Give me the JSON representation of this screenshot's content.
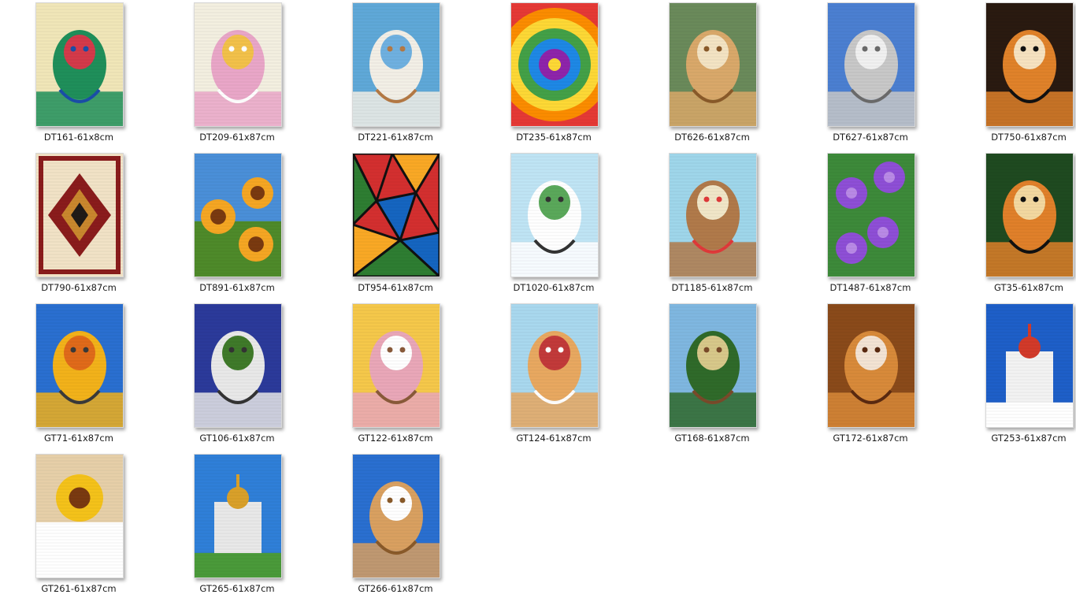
{
  "files": [
    {
      "name": "DT161-61x8cm",
      "art": "peacock",
      "colors": [
        "#f0e6b8",
        "#1f8f5a",
        "#1a4fa8",
        "#d43a4a"
      ]
    },
    {
      "name": "DT209-61x87cm",
      "art": "duck",
      "colors": [
        "#f3efe0",
        "#e9a6c8",
        "#ffffff",
        "#f2c14a"
      ]
    },
    {
      "name": "DT221-61x87cm",
      "art": "rabbit",
      "colors": [
        "#5fa8d8",
        "#f2efe6",
        "#b57a45",
        "#6fb0e0"
      ]
    },
    {
      "name": "DT235-61x87cm",
      "art": "swirl",
      "colors": [
        "#e53935",
        "#fb8c00",
        "#fdd835",
        "#43a047",
        "#1e88e5",
        "#8e24aa"
      ]
    },
    {
      "name": "DT626-61x87cm",
      "art": "horse",
      "colors": [
        "#6a8a5a",
        "#d9a86a",
        "#8a5a2a",
        "#f3e3c3"
      ]
    },
    {
      "name": "DT627-61x87cm",
      "art": "wolf",
      "colors": [
        "#4b7fd1",
        "#c8c8c8",
        "#6b6b6b",
        "#f0f0f0"
      ]
    },
    {
      "name": "DT750-61x87cm",
      "art": "tiger",
      "colors": [
        "#2a1a10",
        "#e0822a",
        "#111111",
        "#f6e2c0"
      ]
    },
    {
      "name": "DT790-61x87cm",
      "art": "rug",
      "colors": [
        "#f1e2c6",
        "#8a1c1c",
        "#1f1a17",
        "#c9872e"
      ]
    },
    {
      "name": "DT891-61x87cm",
      "art": "sunflowers",
      "colors": [
        "#4a8fd8",
        "#f5a623",
        "#7a3a10",
        "#4e8a2a"
      ]
    },
    {
      "name": "DT954-61x87cm",
      "art": "glass",
      "colors": [
        "#d32f2f",
        "#f9a825",
        "#1565c0",
        "#2e7d32",
        "#111111"
      ]
    },
    {
      "name": "DT1020-61x87cm",
      "art": "whitetiger",
      "colors": [
        "#bfe4f4",
        "#ffffff",
        "#333333",
        "#5aa85a"
      ]
    },
    {
      "name": "DT1185-61x87cm",
      "art": "mouse",
      "colors": [
        "#9fd6ea",
        "#b07a4a",
        "#e03a3a",
        "#f0e6c8"
      ]
    },
    {
      "name": "DT1487-61x87cm",
      "art": "violets",
      "colors": [
        "#3d8a3a",
        "#8e4fd6",
        "#b98ae6",
        "#2a6a2a"
      ]
    },
    {
      "name": "GT35-61x87cm",
      "art": "tiger2",
      "colors": [
        "#1f4a20",
        "#e0802a",
        "#111111",
        "#f3d8a0"
      ]
    },
    {
      "name": "GT71-61x87cm",
      "art": "parrot",
      "colors": [
        "#2a6fd0",
        "#f2b21a",
        "#3a3a3a",
        "#e06a1a"
      ]
    },
    {
      "name": "GT106-61x87cm",
      "art": "tiger3",
      "colors": [
        "#2b3a9a",
        "#e8e8e8",
        "#333333",
        "#3f7a2a"
      ]
    },
    {
      "name": "GT122-61x87cm",
      "art": "kitten",
      "colors": [
        "#f5c84a",
        "#e9a7b8",
        "#8a5a3a",
        "#ffffff"
      ]
    },
    {
      "name": "GT124-61x87cm",
      "art": "kitten2",
      "colors": [
        "#a9d8ee",
        "#e8a860",
        "#ffffff",
        "#c23a3a"
      ]
    },
    {
      "name": "GT168-61x87cm",
      "art": "deer",
      "colors": [
        "#7fb7e0",
        "#2f6a2a",
        "#7a4a2a",
        "#d7c88a"
      ]
    },
    {
      "name": "GT172-61x87cm",
      "art": "lion",
      "colors": [
        "#8a4a1a",
        "#d88a3a",
        "#5a2a10",
        "#f3e3d3"
      ]
    },
    {
      "name": "GT253-61x87cm",
      "art": "church",
      "colors": [
        "#1e5fc8",
        "#f2c23a",
        "#d23a2a",
        "#ffffff"
      ]
    },
    {
      "name": "GT261-61x87cm",
      "art": "sunflower",
      "colors": [
        "#e6cfa8",
        "#f4c21a",
        "#4a8a2a",
        "#ffffff"
      ]
    },
    {
      "name": "GT265-61x87cm",
      "art": "cathedral",
      "colors": [
        "#2f7fd8",
        "#e8e8e8",
        "#d9a02a",
        "#4a9a3a"
      ]
    },
    {
      "name": "GT266-61x87cm",
      "art": "horse2",
      "colors": [
        "#2a6fd0",
        "#d9a060",
        "#8a5a2a",
        "#ffffff"
      ]
    }
  ]
}
